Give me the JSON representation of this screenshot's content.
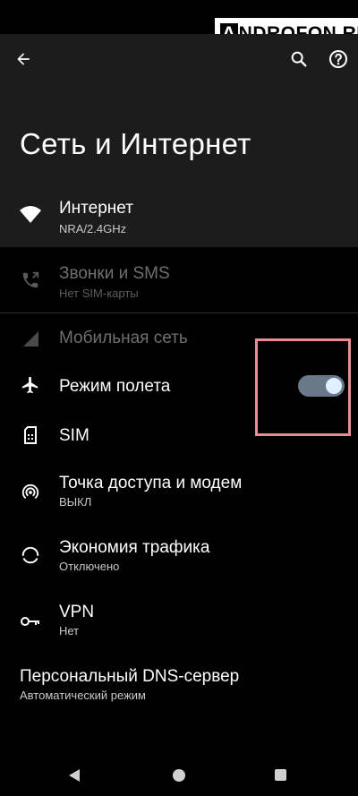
{
  "watermark": {
    "text_a": "A",
    "text_rest": "NDROFON.RU"
  },
  "appbar": {
    "title": "Сеть и Интернет",
    "icons": {
      "back": "arrow-back-icon",
      "search": "search-icon",
      "help": "help-icon"
    }
  },
  "items": {
    "internet": {
      "title": "Интернет",
      "subtitle": "NRA/2.4GHz",
      "icon": "wifi-icon"
    },
    "calls": {
      "title": "Звонки и SMS",
      "subtitle": "Нет SIM-карты",
      "icon": "phone-forward-icon"
    },
    "mobile": {
      "title": "Мобильная сеть",
      "icon": "signal-icon"
    },
    "airplane": {
      "title": "Режим полета",
      "icon": "airplane-icon",
      "toggle_on": true
    },
    "sim": {
      "title": "SIM",
      "icon": "sim-card-icon"
    },
    "hotspot": {
      "title": "Точка доступа и модем",
      "subtitle": "ВЫКЛ",
      "icon": "hotspot-icon"
    },
    "datasaver": {
      "title": "Экономия трафика",
      "subtitle": "Отключено",
      "icon": "data-saver-icon"
    },
    "vpn": {
      "title": "VPN",
      "subtitle": "Нет",
      "icon": "key-icon"
    },
    "dns": {
      "title": "Персональный DNS-сервер",
      "subtitle": "Автоматический режим"
    }
  },
  "colors": {
    "background": "#000000",
    "appbar": "#1c1c1c",
    "toggle_track": "#6a7987",
    "toggle_knob": "#dff0ff",
    "highlight": "#e58f95"
  }
}
